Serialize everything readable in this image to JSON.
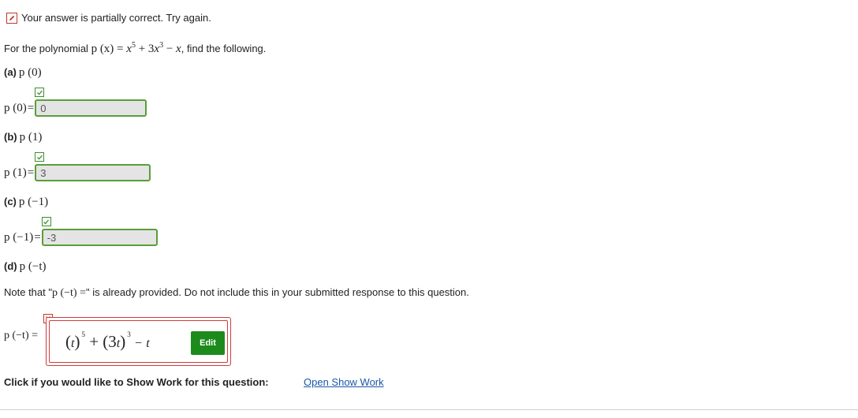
{
  "status": {
    "text": "Your answer is partially correct.  Try again.",
    "color": "#c0392b",
    "icon": "pencil-icon"
  },
  "problem": {
    "prefix": "For the polynomial ",
    "poly_lhs": "p (x) = ",
    "suffix": ", find the following."
  },
  "parts": [
    {
      "label": "(a)",
      "expr": "p (0)",
      "lhs": "p (0)",
      "answer": "0",
      "result": "correct"
    },
    {
      "label": "(b)",
      "expr": "p (1)",
      "lhs": "p (1)",
      "answer": "3",
      "result": "correct"
    },
    {
      "label": "(c)",
      "expr": "p (−1)",
      "lhs": "p (−1)",
      "answer": "-3",
      "result": "correct"
    },
    {
      "label": "(d)",
      "expr": "p (−t)",
      "lhs": "p (−t) =",
      "result": "incorrect",
      "edit_label": "Edit"
    }
  ],
  "note": {
    "before": "Note that \"",
    "math": "p (−t) =",
    "after": "\" is already provided. Do not include this in your submitted response to this question."
  },
  "show_work": {
    "prompt": "Click if you would like to Show Work for this question:",
    "link": "Open Show Work"
  },
  "colors": {
    "correct_border": "#5a9e3a",
    "incorrect_border": "#d23b3b",
    "edit_button": "#1c8b1c",
    "link": "#1a56a8"
  }
}
